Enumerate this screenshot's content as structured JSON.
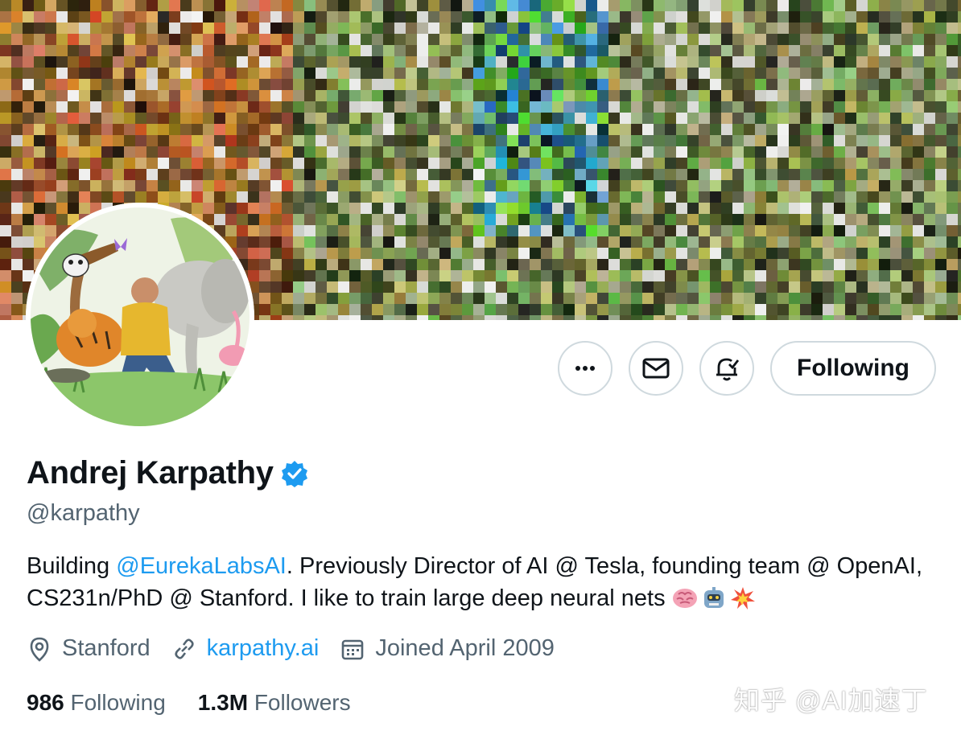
{
  "header": {
    "banner_label": "banner mosaic",
    "avatar_label": "profile illustration"
  },
  "actions": {
    "more_icon": "ellipsis-icon",
    "message_icon": "envelope-icon",
    "notify_icon": "bell-check-icon",
    "follow_label": "Following"
  },
  "profile": {
    "name": "Andrej Karpathy",
    "verified_icon": "verified-badge-icon",
    "handle": "@karpathy",
    "bio": {
      "prefix": "Building ",
      "mention": "@EurekaLabsAI",
      "text": ". Previously Director of AI @ Tesla, founding team @ OpenAI, CS231n/PhD @ Stanford. I like to train large deep neural nets ",
      "emojis": [
        "brain",
        "robot",
        "collision"
      ]
    },
    "location": "Stanford",
    "website": "karpathy.ai",
    "joined": "Joined April 2009"
  },
  "stats": {
    "following_count": "986",
    "following_label": "Following",
    "followers_count": "1.3M",
    "followers_label": "Followers"
  },
  "watermark": "知乎 @AI加速丁",
  "colors": {
    "link": "#1d9bf0",
    "secondary_text": "#536471",
    "border": "#cfd9de",
    "verified": "#1d9bf0"
  }
}
